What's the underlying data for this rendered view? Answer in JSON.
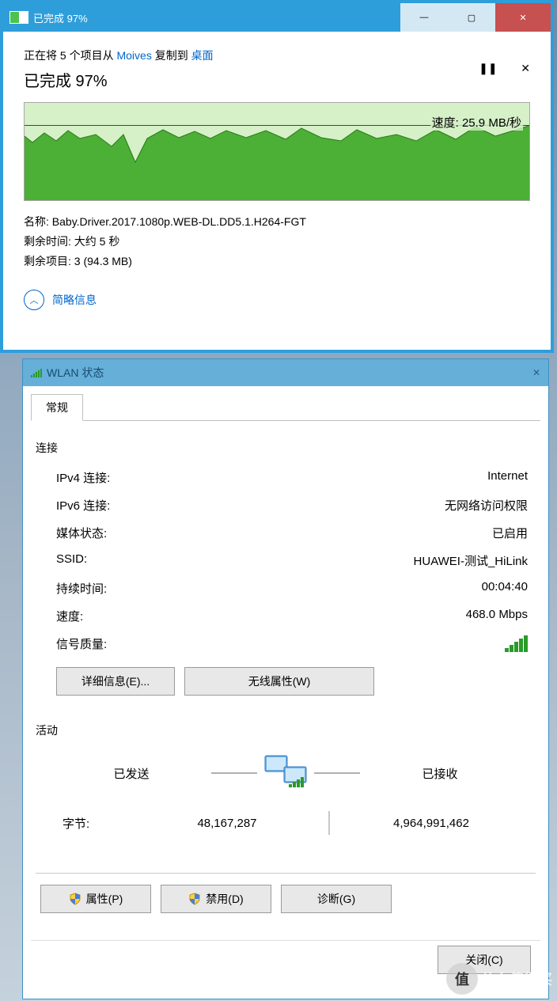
{
  "copy": {
    "title": "已完成 97%",
    "line_prefix": "正在将 5 个项目从 ",
    "source_link": "Moives",
    "line_mid": " 复制到 ",
    "dest_link": "桌面",
    "progress_title": "已完成 97%",
    "speed_label": "速度: 25.9 MB/秒",
    "name_label": "名称:",
    "name_value": "Baby.Driver.2017.1080p.WEB-DL.DD5.1.H264-FGT",
    "remaining_time_label": "剩余时间:",
    "remaining_time_value": "大约 5 秒",
    "remaining_items_label": "剩余项目:",
    "remaining_items_value": "3 (94.3 MB)",
    "footer_text": "简略信息",
    "pause_icon": "❚❚",
    "close_icon": "✕",
    "minimize": "—",
    "maximize": "▢",
    "close_x": "✕",
    "chevron": "︿"
  },
  "wlan": {
    "title": "WLAN 状态",
    "tab": "常规",
    "section_conn": "连接",
    "rows": [
      {
        "k": "IPv4 连接:",
        "v": "Internet"
      },
      {
        "k": "IPv6 连接:",
        "v": "无网络访问权限"
      },
      {
        "k": "媒体状态:",
        "v": "已启用"
      },
      {
        "k": "SSID:",
        "v": "HUAWEI-测试_HiLink"
      },
      {
        "k": "持续时间:",
        "v": "00:04:40"
      },
      {
        "k": "速度:",
        "v": "468.0 Mbps"
      }
    ],
    "signal_quality": "信号质量:",
    "details_btn": "详细信息(E)...",
    "wireless_props_btn": "无线属性(W)",
    "section_activity": "活动",
    "sent_label": "已发送",
    "recv_label": "已接收",
    "bytes_label": "字节:",
    "bytes_sent": "48,167,287",
    "bytes_recv": "4,964,991,462",
    "props_btn": "属性(P)",
    "disable_btn": "禁用(D)",
    "diagnose_btn": "诊断(G)",
    "close_btn": "关闭(C)",
    "close_x": "✕"
  },
  "watermark": {
    "symbol": "值",
    "text": "什么值得买"
  }
}
